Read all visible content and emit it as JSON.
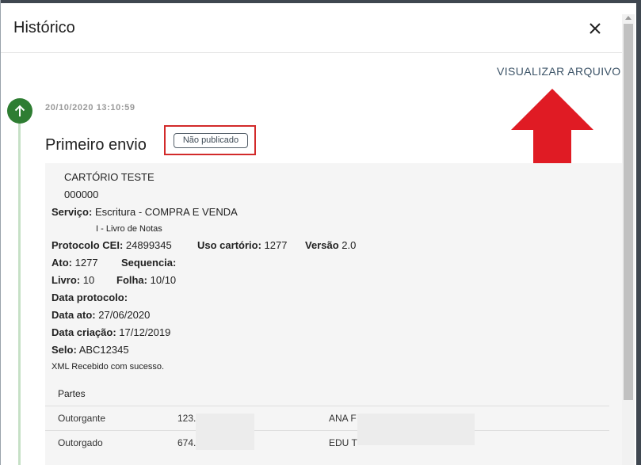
{
  "dialog": {
    "title": "Histórico",
    "close_icon": "close-icon"
  },
  "toolbar": {
    "view_file_label": "VISUALIZAR ARQUIVO"
  },
  "annotation": {
    "arrow_color": "#e01b24",
    "highlight_color": "#d22a2a"
  },
  "timeline": {
    "dot_color": "#2e7d32",
    "dot_icon": "arrow-up-icon",
    "timestamp": "20/10/2020 13:10:59"
  },
  "entry": {
    "title": "Primeiro envio",
    "status_badge": "Não publicado",
    "registry_name": "CARTÓRIO TESTE",
    "registry_code": "000000",
    "service_label": "Serviço:",
    "service_value": "Escritura - COMPRA E VENDA",
    "book_type": "I - Livro de Notas",
    "protocol_cei_label": "Protocolo CEI:",
    "protocol_cei_value": "24899345",
    "uso_cartorio_label": "Uso cartório:",
    "uso_cartorio_value": "1277",
    "versao_label": "Versão",
    "versao_value": "2.0",
    "ato_label": "Ato:",
    "ato_value": "1277",
    "sequencia_label": "Sequencia:",
    "sequencia_value": "",
    "livro_label": "Livro:",
    "livro_value": "10",
    "folha_label": "Folha:",
    "folha_value": "10/10",
    "data_protocolo_label": "Data protocolo:",
    "data_protocolo_value": "",
    "data_ato_label": "Data ato:",
    "data_ato_value": "27/06/2020",
    "data_criacao_label": "Data criação:",
    "data_criacao_value": "17/12/2019",
    "selo_label": "Selo:",
    "selo_value": "ABC12345",
    "message": "XML Recebido com sucesso."
  },
  "parts": {
    "header": "Partes",
    "rows": [
      {
        "role": "Outorgante",
        "document": "123.",
        "name": "ANA F"
      },
      {
        "role": "Outorgado",
        "document": "674.",
        "name": "EDU T"
      }
    ]
  }
}
